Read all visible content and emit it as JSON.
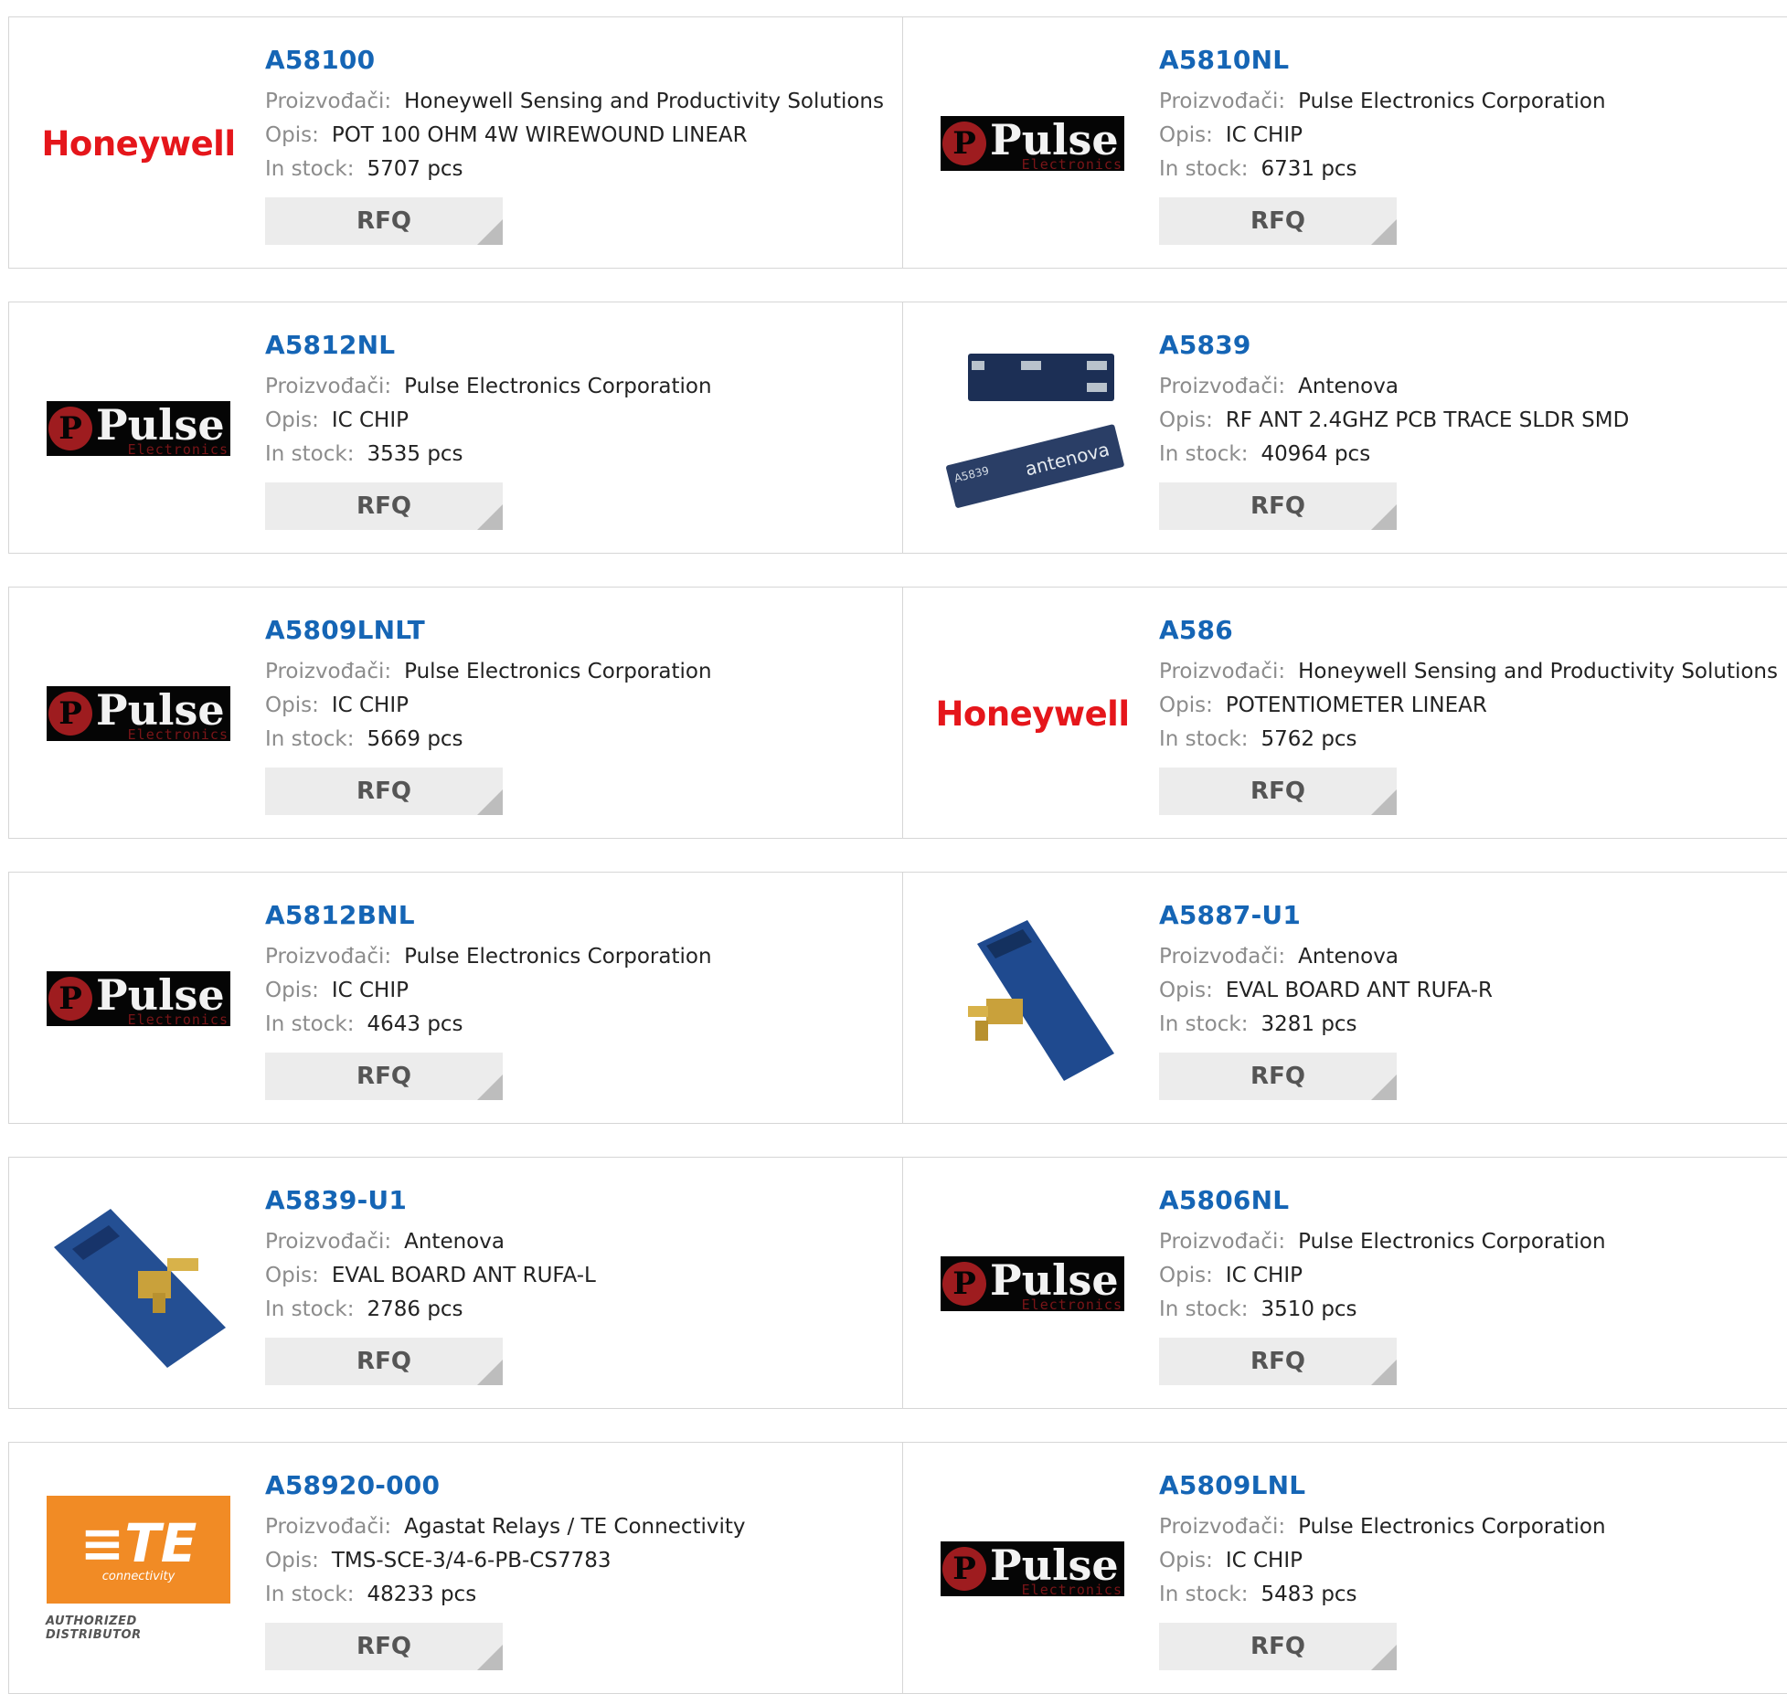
{
  "labels": {
    "manufacturer": "Proizvođači:",
    "description": "Opis:",
    "stock": "In stock:",
    "rfq": "RFQ",
    "te_authorized": "AUTHORIZED DISTRIBUTOR",
    "te_connectivity": "connectivity"
  },
  "logos": {
    "honeywell": "Honeywell",
    "pulse_word": "Pulse",
    "pulse_sub": "Electronics",
    "pulse_mark": "P",
    "te_mark": "≡TE",
    "antenova_text": "antenova",
    "antenova_part": "A5839"
  },
  "products": [
    {
      "part": "A58100",
      "manufacturer": "Honeywell Sensing and Productivity Solutions",
      "description": "POT 100 OHM 4W WIREWOUND LINEAR",
      "stock": "5707 pcs",
      "image": "honeywell-logo"
    },
    {
      "part": "A5810NL",
      "manufacturer": "Pulse Electronics Corporation",
      "description": "IC CHIP",
      "stock": "6731 pcs",
      "image": "pulse-logo"
    },
    {
      "part": "A5812NL",
      "manufacturer": "Pulse Electronics Corporation",
      "description": "IC CHIP",
      "stock": "3535 pcs",
      "image": "pulse-logo"
    },
    {
      "part": "A5839",
      "manufacturer": "Antenova",
      "description": "RF ANT 2.4GHZ PCB TRACE SLDR SMD",
      "stock": "40964 pcs",
      "image": "antenna-chip-photo"
    },
    {
      "part": "A5809LNLT",
      "manufacturer": "Pulse Electronics Corporation",
      "description": "IC CHIP",
      "stock": "5669 pcs",
      "image": "pulse-logo"
    },
    {
      "part": "A586",
      "manufacturer": "Honeywell Sensing and Productivity Solutions",
      "description": "POTENTIOMETER LINEAR",
      "stock": "5762 pcs",
      "image": "honeywell-logo"
    },
    {
      "part": "A5812BNL",
      "manufacturer": "Pulse Electronics Corporation",
      "description": "IC CHIP",
      "stock": "4643 pcs",
      "image": "pulse-logo"
    },
    {
      "part": "A5887-U1",
      "manufacturer": "Antenova",
      "description": "EVAL BOARD ANT RUFA-R",
      "stock": "3281 pcs",
      "image": "eval-board-photo"
    },
    {
      "part": "A5839-U1",
      "manufacturer": "Antenova",
      "description": "EVAL BOARD ANT RUFA-L",
      "stock": "2786 pcs",
      "image": "eval-board-photo"
    },
    {
      "part": "A5806NL",
      "manufacturer": "Pulse Electronics Corporation",
      "description": "IC CHIP",
      "stock": "3510 pcs",
      "image": "pulse-logo"
    },
    {
      "part": "A58920-000",
      "manufacturer": "Agastat Relays / TE Connectivity",
      "description": "TMS-SCE-3/4-6-PB-CS7783",
      "stock": "48233 pcs",
      "image": "te-logo"
    },
    {
      "part": "A5809LNL",
      "manufacturer": "Pulse Electronics Corporation",
      "description": "IC CHIP",
      "stock": "5483 pcs",
      "image": "pulse-logo"
    }
  ],
  "colors": {
    "part_link": "#1565b5",
    "honeywell_red": "#e5161b",
    "pulse_red": "#9e1c1f",
    "te_orange": "#f18b25",
    "rfq_bg": "#ececec",
    "card_border": "#d6d6d6"
  }
}
